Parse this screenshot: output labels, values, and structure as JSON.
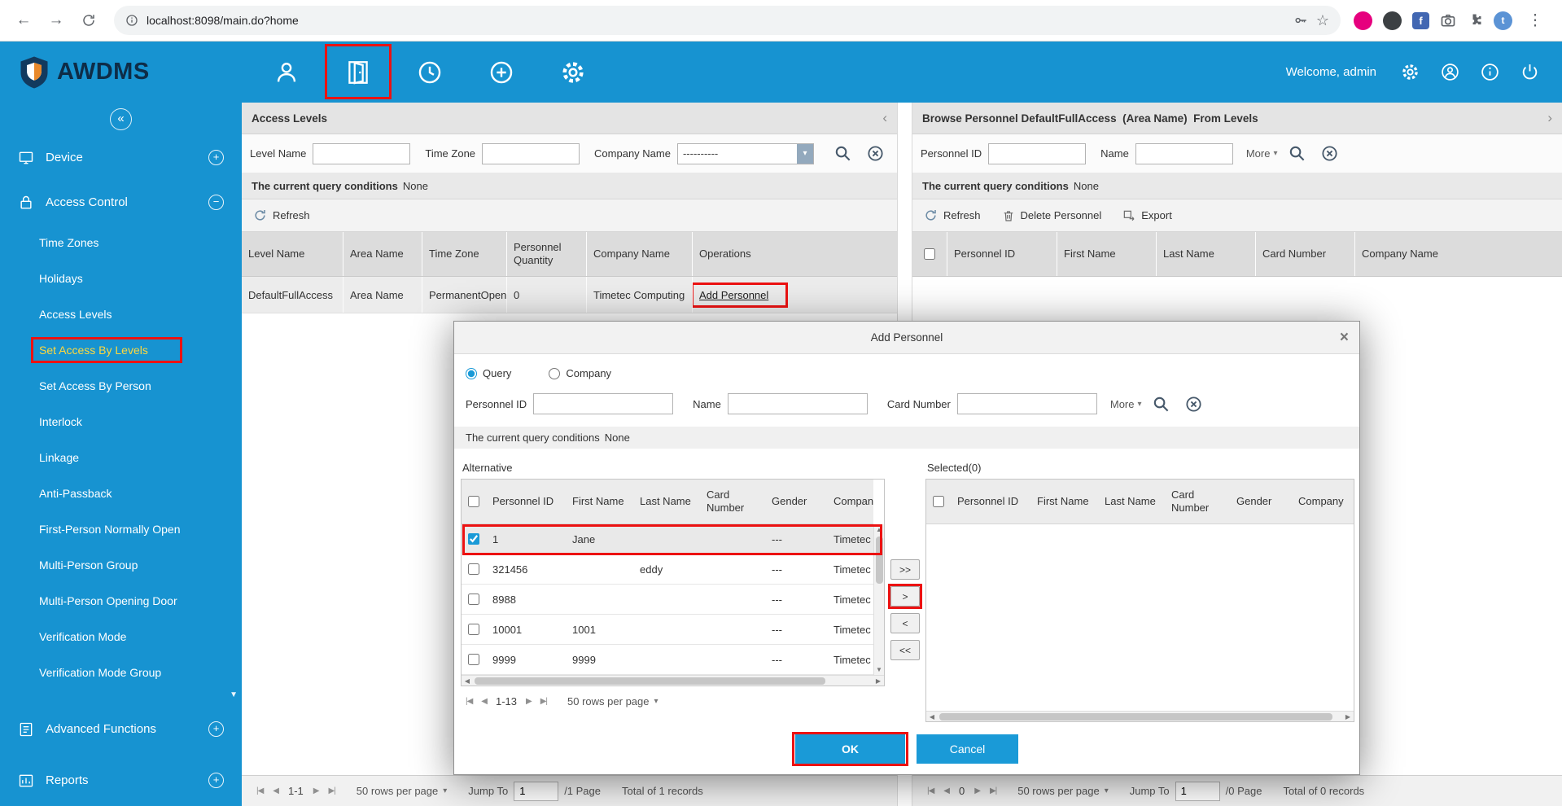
{
  "browser": {
    "url": "localhost:8098/main.do?home"
  },
  "app_header": {
    "logo_text": "AWDMS",
    "welcome_text": "Welcome, admin"
  },
  "sidebar": {
    "modules": [
      {
        "label": "Device",
        "toggle": "+"
      },
      {
        "label": "Access Control",
        "toggle": "−"
      }
    ],
    "submenu": [
      {
        "label": "Time Zones"
      },
      {
        "label": "Holidays"
      },
      {
        "label": "Access Levels"
      },
      {
        "label": "Set Access By Levels"
      },
      {
        "label": "Set Access By Person"
      },
      {
        "label": "Interlock"
      },
      {
        "label": "Linkage"
      },
      {
        "label": "Anti-Passback"
      },
      {
        "label": "First-Person Normally Open"
      },
      {
        "label": "Multi-Person Group"
      },
      {
        "label": "Multi-Person Opening Door"
      },
      {
        "label": "Verification Mode"
      },
      {
        "label": "Verification Mode Group"
      }
    ],
    "modules_bottom": [
      {
        "label": "Advanced Functions",
        "toggle": "+"
      },
      {
        "label": "Reports",
        "toggle": "+"
      }
    ]
  },
  "left_panel": {
    "title": "Access Levels",
    "filters": {
      "level_name_label": "Level Name",
      "time_zone_label": "Time Zone",
      "company_name_label": "Company Name",
      "company_name_value": "----------"
    },
    "query_label": "The current query conditions",
    "query_value": "None",
    "refresh_label": "Refresh",
    "table": {
      "columns": [
        "Level Name",
        "Area Name",
        "Time Zone",
        "Personnel Quantity",
        "Company Name",
        "Operations"
      ],
      "row": {
        "level_name": "DefaultFullAccess",
        "area_name": "Area Name",
        "time_zone": "PermanentOpen",
        "personnel_quantity": "0",
        "company_name": "Timetec Computing",
        "operation": "Add Personnel"
      }
    },
    "pagination": {
      "range": "1-1",
      "rows_per_page": "50 rows per page",
      "jump_label": "Jump To",
      "jump_value": "1",
      "page_suffix": "/1 Page",
      "total": "Total of 1 records"
    }
  },
  "right_panel": {
    "title": "Browse Personnel DefaultFullAccess  (Area Name)  From Levels",
    "filters": {
      "personnel_id_label": "Personnel ID",
      "name_label": "Name",
      "more_label": "More"
    },
    "query_label": "The current query conditions",
    "query_value": "None",
    "toolbar": {
      "refresh": "Refresh",
      "delete": "Delete Personnel",
      "export": "Export"
    },
    "table": {
      "columns": [
        "Personnel ID",
        "First Name",
        "Last Name",
        "Card Number",
        "Company Name"
      ]
    },
    "pagination": {
      "range": "0",
      "rows_per_page": "50 rows per page",
      "jump_label": "Jump To",
      "jump_value": "1",
      "page_suffix": "/0 Page",
      "total": "Total of 0 records"
    }
  },
  "modal": {
    "title": "Add Personnel",
    "radio_query": "Query",
    "radio_company": "Company",
    "radio_query_checked": true,
    "filters": {
      "personnel_id_label": "Personnel ID",
      "name_label": "Name",
      "card_number_label": "Card Number",
      "more_label": "More"
    },
    "query_label": "The current query conditions",
    "query_value": "None",
    "alternative": {
      "title": "Alternative",
      "columns": [
        "Personnel ID",
        "First Name",
        "Last Name",
        "Card Number",
        "Gender",
        "Company"
      ],
      "rows": [
        {
          "personnel_id": "1",
          "first_name": "Jane",
          "last_name": "",
          "card_number": "",
          "gender": "---",
          "company": "Timetec",
          "checked": true
        },
        {
          "personnel_id": "321456",
          "first_name": "",
          "last_name": "eddy",
          "card_number": "",
          "gender": "---",
          "company": "Timetec"
        },
        {
          "personnel_id": "8988",
          "first_name": "",
          "last_name": "",
          "card_number": "",
          "gender": "---",
          "company": "Timetec"
        },
        {
          "personnel_id": "10001",
          "first_name": "1001",
          "last_name": "",
          "card_number": "",
          "gender": "---",
          "company": "Timetec"
        },
        {
          "personnel_id": "9999",
          "first_name": "9999",
          "last_name": "",
          "card_number": "",
          "gender": "---",
          "company": "Timetec"
        }
      ],
      "pagination_range": "1-13",
      "rows_per_page": "50 rows per page"
    },
    "selected": {
      "title": "Selected(0)",
      "columns": [
        "Personnel ID",
        "First Name",
        "Last Name",
        "Card Number",
        "Gender",
        "Company"
      ]
    },
    "transfer": {
      "move_all_right": ">>",
      "move_right": ">",
      "move_left": "<",
      "move_all_left": "<<"
    },
    "ok_label": "OK",
    "cancel_label": "Cancel"
  },
  "icons": {
    "back": "←",
    "forward": "→",
    "menu_dots": "⋮",
    "star": "☆",
    "collapse": "«",
    "chevron_left": "‹",
    "chevron_right": "›",
    "dropdown": "▾",
    "pg_first": "|◀",
    "pg_prev": "◀",
    "pg_next": "▶",
    "pg_last": "▶|",
    "close": "×",
    "scroll_down": "▼",
    "scroll_up": "▲",
    "fb_letter": "f",
    "avatar_letter": "t"
  },
  "colors": {
    "header_blue": "#1793d1",
    "accent_blue": "#1a9ad7",
    "annotation_red": "#ec1212",
    "active_item_yellow": "#ffd83d"
  }
}
